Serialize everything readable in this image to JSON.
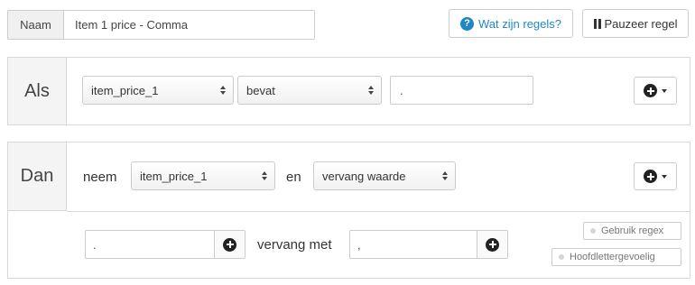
{
  "header": {
    "name_label": "Naam",
    "name_value": "Item 1 price - Comma",
    "help_label": "Wat zijn regels?",
    "help_icon": "?",
    "pause_label": "Pauzeer regel"
  },
  "if_block": {
    "label": "Als",
    "field_select": "item_price_1",
    "operator_select": "bevat",
    "value": "."
  },
  "then_block": {
    "label": "Dan",
    "take_word": "neem",
    "field_select": "item_price_1",
    "and_word": "en",
    "action_select": "vervang waarde",
    "find_value": ".",
    "replace_word": "vervang met",
    "replace_value": ",",
    "regex_label": "Gebruik regex",
    "case_label": "Hoofdlettergevoelig"
  },
  "colors": {
    "accent": "#1e88c7",
    "panel_side_bg": "#f4f4f4",
    "border": "#d8d8d8"
  }
}
